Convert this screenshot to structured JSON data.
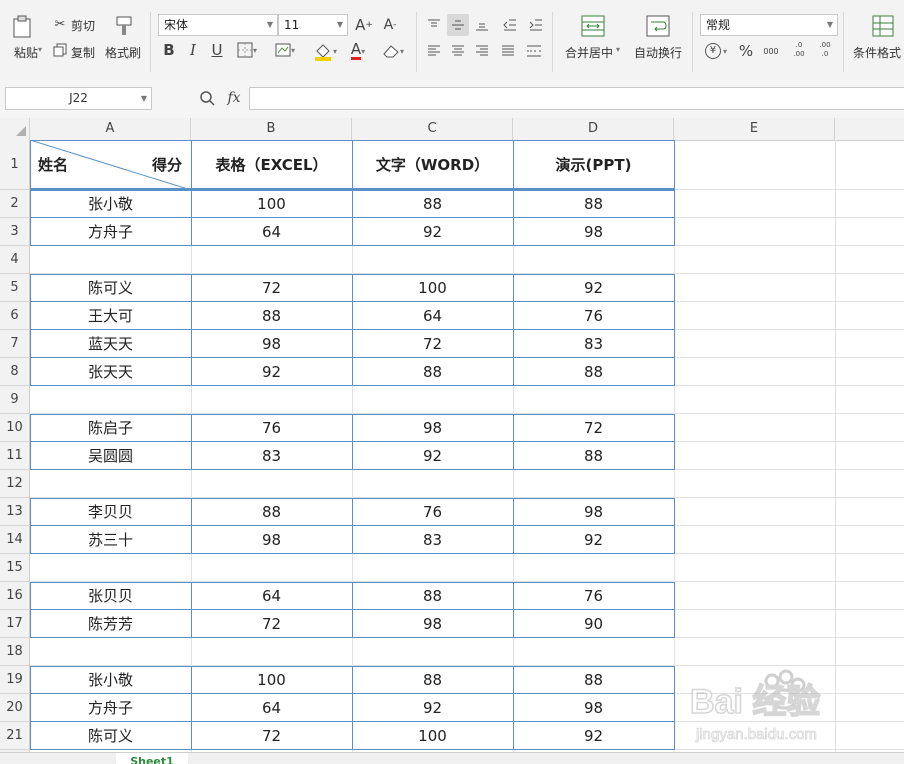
{
  "ribbon": {
    "paste_label": "粘贴",
    "cut_label": "剪切",
    "copy_label": "复制",
    "format_painter_label": "格式刷",
    "font_name": "宋体",
    "font_size": "11",
    "merge_center_label": "合并居中",
    "wrap_text_label": "自动换行",
    "number_format": "常规",
    "conditional_format_label": "条件格式",
    "currency_symbol": "¥",
    "percent_symbol": "%",
    "thousands_label": "000",
    "dec_inc_label": ".0 .00",
    "dec_dec_label": ".00 .0"
  },
  "formula_bar": {
    "cell_ref": "J22",
    "fx_label": "fx",
    "formula": ""
  },
  "columns": [
    "A",
    "B",
    "C",
    "D",
    "E"
  ],
  "rows": [
    "1",
    "2",
    "3",
    "4",
    "5",
    "6",
    "7",
    "8",
    "9",
    "10",
    "11",
    "12",
    "13",
    "14",
    "15",
    "16",
    "17",
    "18",
    "19",
    "20",
    "21"
  ],
  "table": {
    "header_name": "姓名",
    "header_score": "得分",
    "header_b": "表格（EXCEL）",
    "header_c": "文字（WORD）",
    "header_d": "演示(PPT)",
    "data": [
      {
        "row": 2,
        "name": "张小敬",
        "b": "100",
        "c": "88",
        "d": "88"
      },
      {
        "row": 3,
        "name": "方舟子",
        "b": "64",
        "c": "92",
        "d": "98"
      },
      {
        "row": 5,
        "name": "陈可义",
        "b": "72",
        "c": "100",
        "d": "92"
      },
      {
        "row": 6,
        "name": "王大可",
        "b": "88",
        "c": "64",
        "d": "76"
      },
      {
        "row": 7,
        "name": "蓝天天",
        "b": "98",
        "c": "72",
        "d": "83"
      },
      {
        "row": 8,
        "name": "张天天",
        "b": "92",
        "c": "88",
        "d": "88"
      },
      {
        "row": 10,
        "name": "陈启子",
        "b": "76",
        "c": "98",
        "d": "72"
      },
      {
        "row": 11,
        "name": "吴圆圆",
        "b": "83",
        "c": "92",
        "d": "88"
      },
      {
        "row": 13,
        "name": "李贝贝",
        "b": "88",
        "c": "76",
        "d": "98"
      },
      {
        "row": 14,
        "name": "苏三十",
        "b": "98",
        "c": "83",
        "d": "92"
      },
      {
        "row": 16,
        "name": "张贝贝",
        "b": "64",
        "c": "88",
        "d": "76"
      },
      {
        "row": 17,
        "name": "陈芳芳",
        "b": "72",
        "c": "98",
        "d": "90"
      },
      {
        "row": 19,
        "name": "张小敬",
        "b": "100",
        "c": "88",
        "d": "88"
      },
      {
        "row": 20,
        "name": "方舟子",
        "b": "64",
        "c": "92",
        "d": "98"
      },
      {
        "row": 21,
        "name": "陈可义",
        "b": "72",
        "c": "100",
        "d": "92"
      }
    ]
  },
  "sheet_tab": "Sheet1",
  "watermark": {
    "brand": "Bai 经验",
    "url": "jingyan.baidu.com"
  },
  "colors": {
    "border_blue": "#5b8fc7",
    "accent_green": "#2e8b3a",
    "font_red": "#e02020",
    "fill_yellow": "#f4d000"
  }
}
